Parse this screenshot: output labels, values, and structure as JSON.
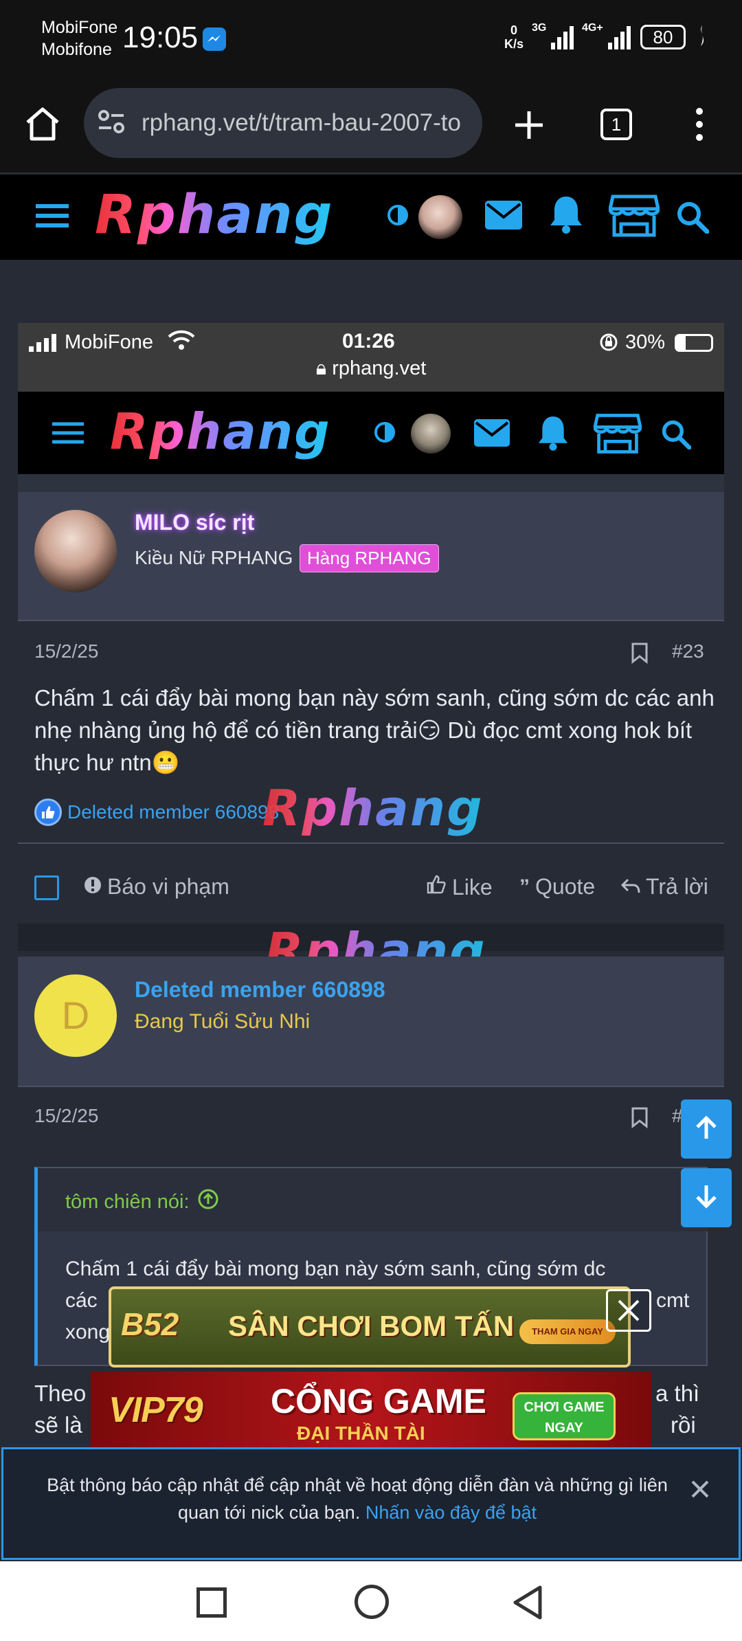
{
  "status_bar": {
    "carrier_line1": "MobiFone",
    "carrier_line2": "Mobifone",
    "time": "19:05",
    "net_speed_value": "0",
    "net_speed_unit": "K/s",
    "net_3g": "3G",
    "net_4g": "4G+",
    "battery": "80"
  },
  "browser": {
    "url": "rphang.vet/t/tram-bau-2007-to",
    "tab_count": "1"
  },
  "site": {
    "logo": "Rphang"
  },
  "inner_screenshot": {
    "carrier": "MobiFone",
    "time": "01:26",
    "battery": "30%",
    "url": "rphang.vet"
  },
  "post1": {
    "username": "MILO síc rịt",
    "user_title": "Kiều Nữ RPHANG",
    "badge": "Hàng RPHANG",
    "date": "15/2/25",
    "number": "#23",
    "content": "Chấm 1 cái đẩy bài mong bạn này sớm sanh, cũng sớm dc các anh nhẹ nhàng ủng hộ để có tiền trang trải😏 Dù đọc cmt xong hok bít thực hư ntn😬",
    "reaction_user": "Deleted member 660898",
    "report_label": "Báo vi phạm",
    "like_label": "Like",
    "quote_label": "Quote",
    "reply_label": "Trả lời"
  },
  "watermark": "Rphang",
  "post2": {
    "avatar_letter": "D",
    "username": "Deleted member 660898",
    "user_title": "Đang Tuổi Sửu Nhi",
    "date": "15/2/25",
    "number_partial": "#",
    "quote_author": "tôm chiên nói:",
    "quote_line1": "Chấm 1 cái đẩy bài mong bạn này sớm sanh, cũng sớm dc",
    "quote_line2_start": "các",
    "quote_line2_end": "cmt",
    "quote_line3_start": "xong",
    "body_line1_start": "Theo",
    "body_line1_end": "a thì",
    "body_line2_start": "sẽ là",
    "body_line2_end": "rồi"
  },
  "ads": {
    "ad1_brand": "B52",
    "ad1_text": "SÂN CHƠI BOM TẤN",
    "ad1_button": "THAM GIA NGAY",
    "ad2_brand": "VIP79",
    "ad2_text": "CỔNG GAME",
    "ad2_subtext": "ĐẠI THẦN TÀI",
    "ad2_button": "CHƠI GAME NGAY"
  },
  "notice": {
    "text": "Bật thông báo cập nhật để cập nhật về hoạt động diễn đàn và những gì liên quan tới nick của bạn.",
    "link": "Nhấn vào đây để bật"
  },
  "colors": {
    "accent_blue": "#2a98e8",
    "username_purple": "#c77dff",
    "badge_pink": "#e04fd8",
    "title_yellow": "#e8c94a",
    "quote_green": "#7ecb4a"
  }
}
